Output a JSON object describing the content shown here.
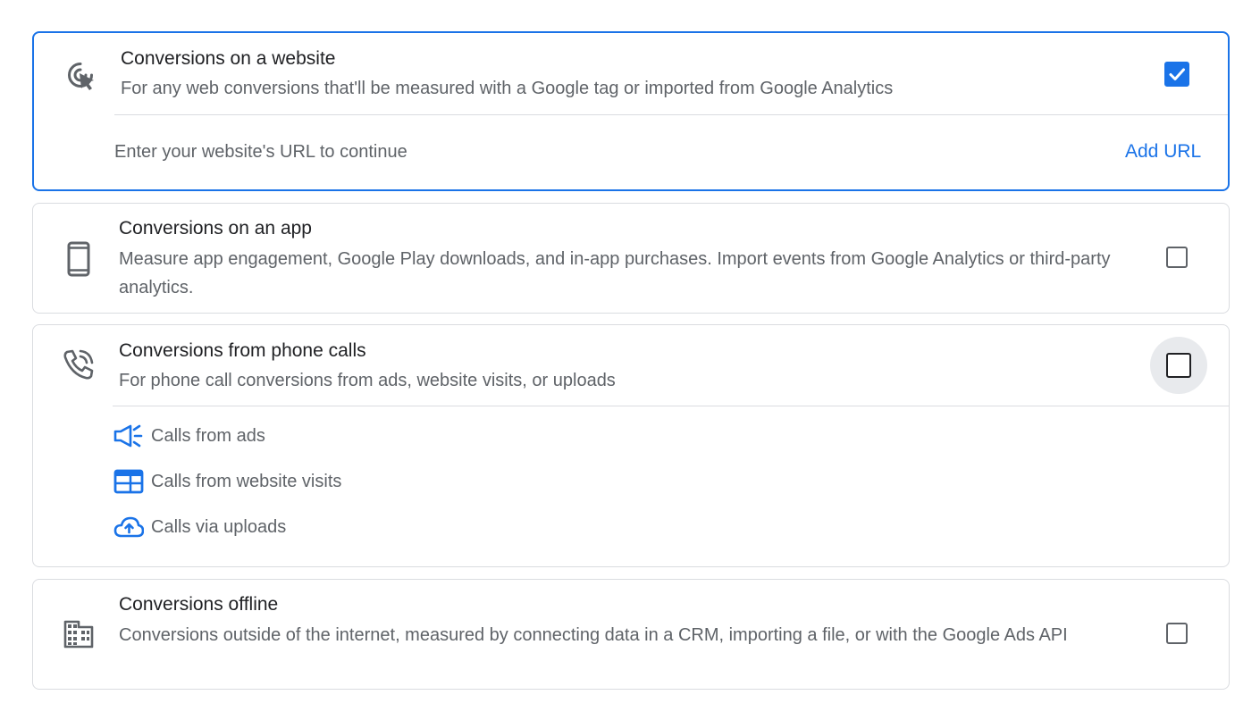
{
  "website": {
    "title": "Conversions on a website",
    "description": "For any web conversions that'll be measured with a Google tag or imported from Google Analytics",
    "checked": true,
    "url_prompt": "Enter your website's URL to continue",
    "add_url_label": "Add URL",
    "icon": "ads-click-icon"
  },
  "app": {
    "title": "Conversions on an app",
    "description": "Measure app engagement, Google Play downloads, and in-app purchases. Import events from Google Analytics or third-party analytics.",
    "checked": false,
    "icon": "smartphone-icon"
  },
  "phone": {
    "title": "Conversions from phone calls",
    "description": "For phone call conversions from ads, website visits, or uploads",
    "checked": false,
    "icon": "phone-call-icon",
    "sub_items": [
      {
        "label": "Calls from ads",
        "icon": "campaign-icon"
      },
      {
        "label": "Calls from website visits",
        "icon": "web-icon"
      },
      {
        "label": "Calls via uploads",
        "icon": "cloud-upload-icon"
      }
    ]
  },
  "offline": {
    "title": "Conversions offline",
    "description": "Conversions outside of the internet, measured by connecting data in a CRM, importing a file, or with the Google Ads API",
    "checked": false,
    "icon": "building-icon"
  },
  "colors": {
    "accent": "#1a73e8",
    "border": "#dadce0",
    "text_primary": "#202124",
    "text_secondary": "#5f6368"
  }
}
